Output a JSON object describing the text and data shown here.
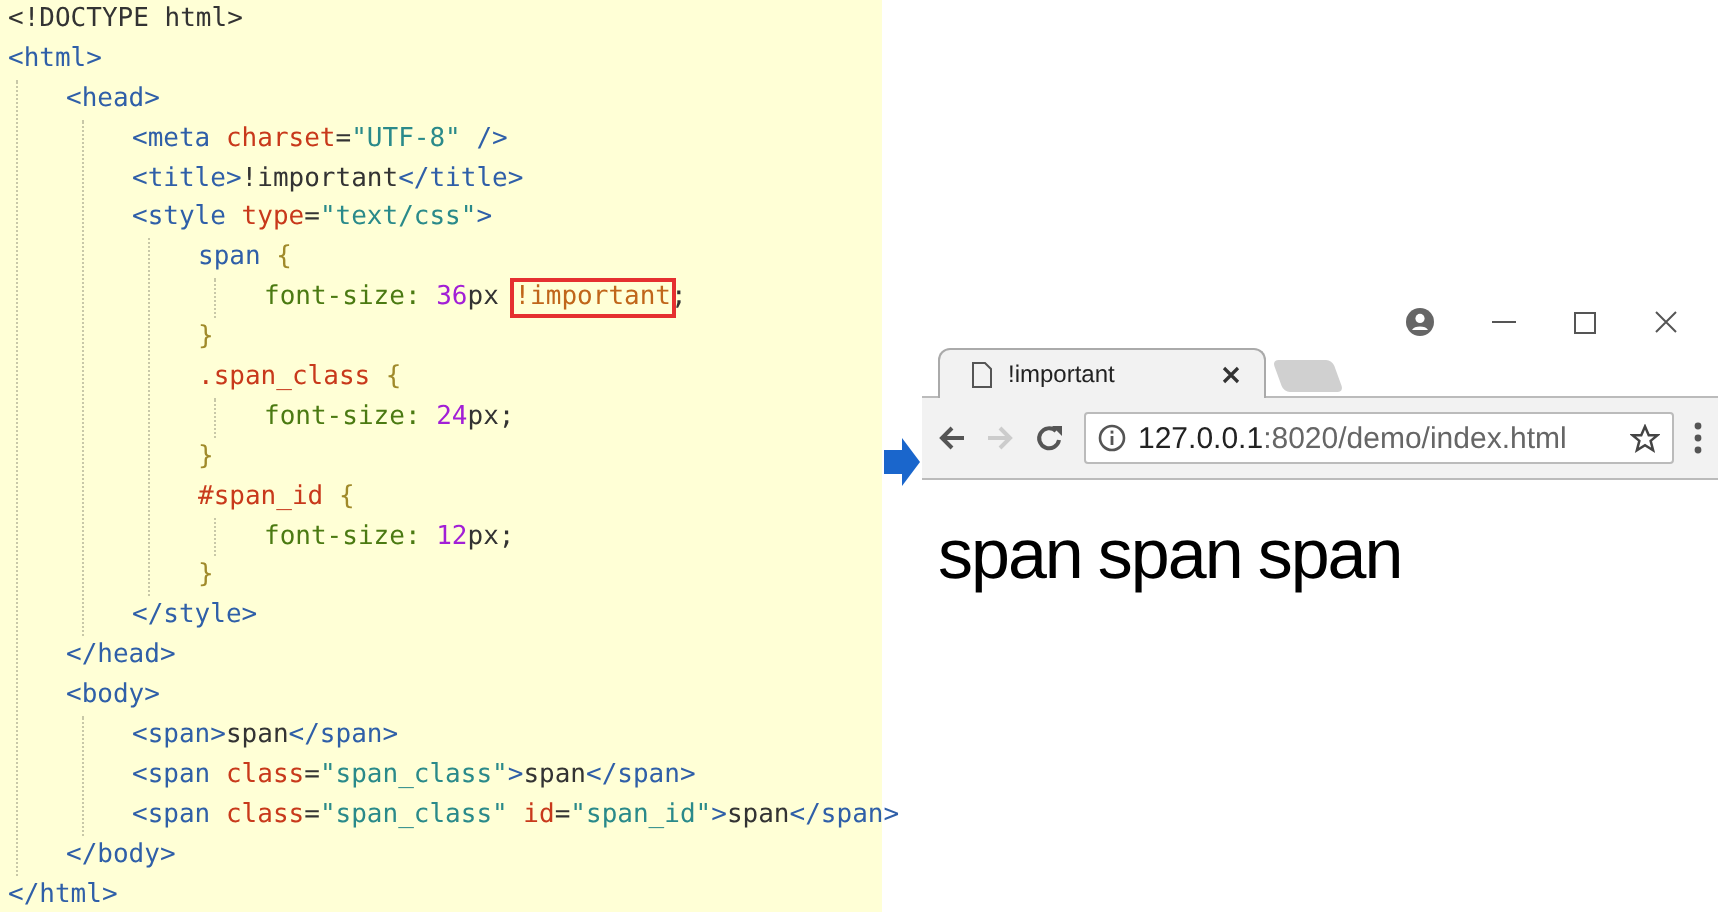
{
  "code_editor": {
    "lines": [
      {
        "tokens": [
          {
            "text": "<!DOCTYPE html>",
            "kind": "text"
          }
        ]
      },
      {
        "tokens": [
          {
            "text": "<html>",
            "kind": "tag"
          }
        ],
        "children": [
          {
            "tokens": [
              {
                "text": "<head>",
                "kind": "tag"
              }
            ],
            "children": [
              {
                "tokens": [
                  {
                    "text": "<meta ",
                    "kind": "tag"
                  },
                  {
                    "text": "charset",
                    "kind": "attr"
                  },
                  {
                    "text": "=",
                    "kind": "text"
                  },
                  {
                    "text": "\"UTF-8\"",
                    "kind": "string"
                  },
                  {
                    "text": " />",
                    "kind": "tag"
                  }
                ]
              },
              {
                "tokens": [
                  {
                    "text": "<title>",
                    "kind": "tag"
                  },
                  {
                    "text": "!important",
                    "kind": "text"
                  },
                  {
                    "text": "</title>",
                    "kind": "tag"
                  }
                ]
              },
              {
                "tokens": [
                  {
                    "text": "<style ",
                    "kind": "tag"
                  },
                  {
                    "text": "type",
                    "kind": "attr"
                  },
                  {
                    "text": "=",
                    "kind": "text"
                  },
                  {
                    "text": "\"text/css\"",
                    "kind": "string"
                  },
                  {
                    "text": ">",
                    "kind": "tag"
                  }
                ],
                "children": [
                  {
                    "tokens": [
                      {
                        "text": "span ",
                        "kind": "tag"
                      },
                      {
                        "text": "{",
                        "kind": "brace"
                      }
                    ],
                    "children": [
                      {
                        "tokens": [
                          {
                            "text": "font-size: ",
                            "kind": "property"
                          },
                          {
                            "text": "36",
                            "kind": "number"
                          },
                          {
                            "text": "px ",
                            "kind": "text"
                          },
                          {
                            "text": "!important",
                            "kind": "highlight"
                          },
                          {
                            "text": ";",
                            "kind": "text"
                          }
                        ]
                      }
                    ]
                  },
                  {
                    "tokens": [
                      {
                        "text": "}",
                        "kind": "brace"
                      }
                    ]
                  },
                  {
                    "tokens": [
                      {
                        "text": ".span_class ",
                        "kind": "attr"
                      },
                      {
                        "text": "{",
                        "kind": "brace"
                      }
                    ],
                    "children": [
                      {
                        "tokens": [
                          {
                            "text": "font-size: ",
                            "kind": "property"
                          },
                          {
                            "text": "24",
                            "kind": "number"
                          },
                          {
                            "text": "px;",
                            "kind": "text"
                          }
                        ]
                      }
                    ]
                  },
                  {
                    "tokens": [
                      {
                        "text": "}",
                        "kind": "brace"
                      }
                    ]
                  },
                  {
                    "tokens": [
                      {
                        "text": "#span_id ",
                        "kind": "attr"
                      },
                      {
                        "text": "{",
                        "kind": "brace"
                      }
                    ],
                    "children": [
                      {
                        "tokens": [
                          {
                            "text": "font-size: ",
                            "kind": "property"
                          },
                          {
                            "text": "12",
                            "kind": "number"
                          },
                          {
                            "text": "px;",
                            "kind": "text"
                          }
                        ]
                      }
                    ]
                  },
                  {
                    "tokens": [
                      {
                        "text": "}",
                        "kind": "brace"
                      }
                    ]
                  }
                ]
              },
              {
                "tokens": [
                  {
                    "text": "</style>",
                    "kind": "tag"
                  }
                ]
              }
            ]
          },
          {
            "tokens": [
              {
                "text": "</head>",
                "kind": "tag"
              }
            ]
          },
          {
            "tokens": [
              {
                "text": "<body>",
                "kind": "tag"
              }
            ],
            "children": [
              {
                "tokens": [
                  {
                    "text": "<span>",
                    "kind": "tag"
                  },
                  {
                    "text": "span",
                    "kind": "text"
                  },
                  {
                    "text": "</span>",
                    "kind": "tag"
                  }
                ]
              },
              {
                "tokens": [
                  {
                    "text": "<span ",
                    "kind": "tag"
                  },
                  {
                    "text": "class",
                    "kind": "attr"
                  },
                  {
                    "text": "=",
                    "kind": "text"
                  },
                  {
                    "text": "\"span_class\"",
                    "kind": "string"
                  },
                  {
                    "text": ">",
                    "kind": "tag"
                  },
                  {
                    "text": "span",
                    "kind": "text"
                  },
                  {
                    "text": "</span>",
                    "kind": "tag"
                  }
                ]
              },
              {
                "tokens": [
                  {
                    "text": "<span ",
                    "kind": "tag"
                  },
                  {
                    "text": "class",
                    "kind": "attr"
                  },
                  {
                    "text": "=",
                    "kind": "text"
                  },
                  {
                    "text": "\"span_class\"",
                    "kind": "string"
                  },
                  {
                    "text": " id",
                    "kind": "attr"
                  },
                  {
                    "text": "=",
                    "kind": "text"
                  },
                  {
                    "text": "\"span_id\"",
                    "kind": "string"
                  },
                  {
                    "text": ">",
                    "kind": "tag"
                  },
                  {
                    "text": "span",
                    "kind": "text"
                  },
                  {
                    "text": "</span>",
                    "kind": "tag"
                  }
                ]
              }
            ]
          },
          {
            "tokens": [
              {
                "text": "</body>",
                "kind": "tag"
              }
            ]
          }
        ]
      },
      {
        "tokens": [
          {
            "text": "</html>",
            "kind": "tag"
          }
        ]
      }
    ]
  },
  "browser": {
    "tab": {
      "title": "!important"
    },
    "forward_button": {
      "disabled": true
    },
    "address": {
      "host": "127.0.0.1",
      "path": ":8020/demo/index.html"
    },
    "page_texts": [
      "span",
      "span",
      "span"
    ]
  }
}
